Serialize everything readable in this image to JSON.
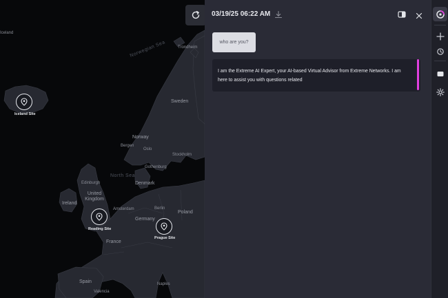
{
  "map": {
    "labels": {
      "iceland": "Iceland",
      "norwegian_sea": "Norwegian Sea",
      "sweden": "Sweden",
      "norway": "Norway",
      "bergen": "Bergen",
      "oslo": "Oslo",
      "stockholm": "Stockholm",
      "gothenburg": "Gothenburg",
      "north_sea": "North Sea",
      "denmark": "Denmark",
      "edinburgh": "Edinburgh",
      "united_kingdom": "United Kingdom",
      "ireland": "Ireland",
      "amsterdam": "Amsterdam",
      "berlin": "Berlin",
      "poland": "Poland",
      "germany": "Germany",
      "france": "France",
      "spain": "Spain",
      "naples": "Naples",
      "valencia": "Valencia",
      "trondheim": "Trondheim"
    },
    "sites": {
      "iceland": "Iceland Site",
      "reading": "Reading Site",
      "prague": "Prague Site"
    }
  },
  "chat": {
    "timestamp": "03/19/25 06:22 AM",
    "user_message": "who are you?",
    "bot_message": "I am the Extreme AI Expert, your AI-based Virtual Advisor from Extreme Networks. I am here to assist you with questions related"
  },
  "colors": {
    "accent": "#e13fe0",
    "panel_bg": "#2a2b36",
    "bot_bubble_bg": "#1e1f29",
    "user_bubble_bg": "#dcdde3"
  }
}
